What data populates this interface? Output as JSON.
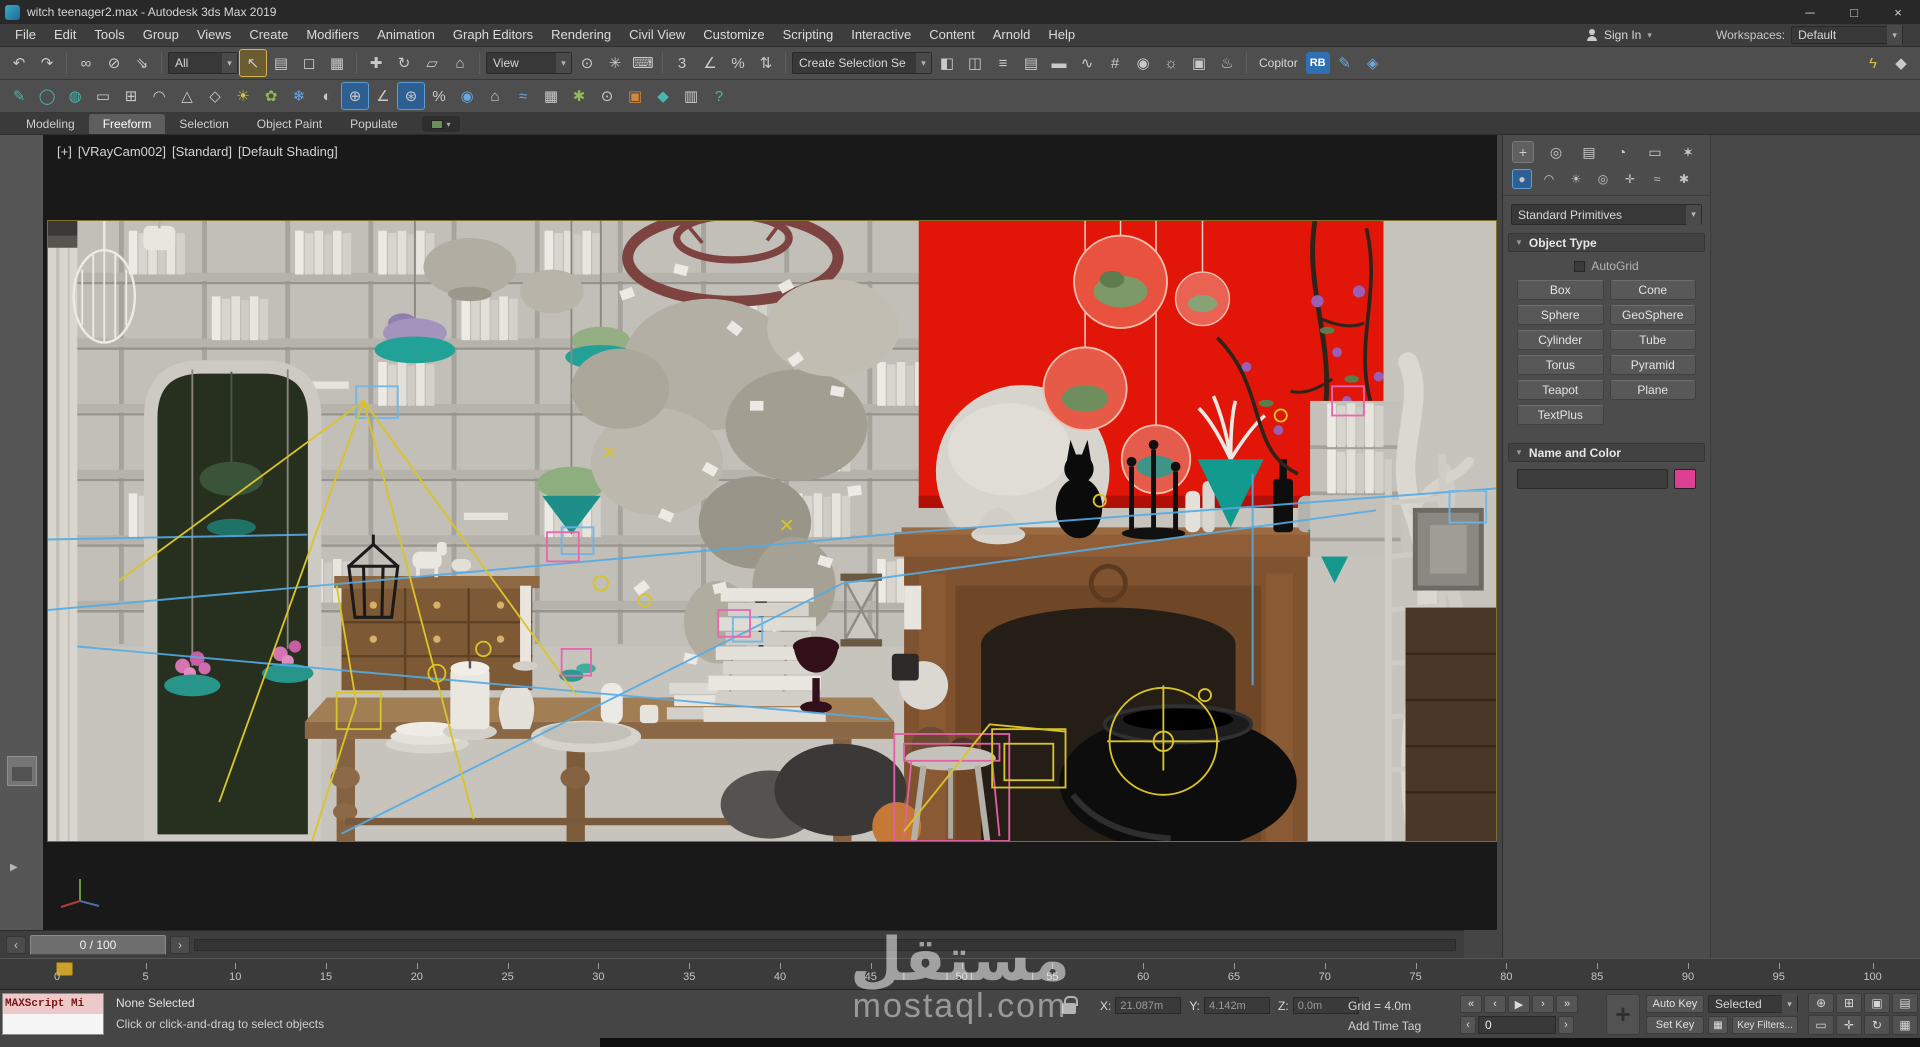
{
  "titlebar": {
    "title": "witch teenager2.max - Autodesk 3ds Max 2019"
  },
  "window_controls": [
    {
      "g": "─",
      "n": "minimize-button"
    },
    {
      "g": "□",
      "n": "maximize-button"
    },
    {
      "g": "×",
      "n": "close-button"
    }
  ],
  "menubar": {
    "items": [
      {
        "l": "File",
        "n": "menu-file"
      },
      {
        "l": "Edit",
        "n": "menu-edit"
      },
      {
        "l": "Tools",
        "n": "menu-tools"
      },
      {
        "l": "Group",
        "n": "menu-group"
      },
      {
        "l": "Views",
        "n": "menu-views"
      },
      {
        "l": "Create",
        "n": "menu-create"
      },
      {
        "l": "Modifiers",
        "n": "menu-modifiers"
      },
      {
        "l": "Animation",
        "n": "menu-animation"
      },
      {
        "l": "Graph Editors",
        "n": "menu-graph-editors"
      },
      {
        "l": "Rendering",
        "n": "menu-rendering"
      },
      {
        "l": "Civil View",
        "n": "menu-civil-view"
      },
      {
        "l": "Customize",
        "n": "menu-customize"
      },
      {
        "l": "Scripting",
        "n": "menu-scripting"
      },
      {
        "l": "Interactive",
        "n": "menu-interactive"
      },
      {
        "l": "Content",
        "n": "menu-content"
      },
      {
        "l": "Arnold",
        "n": "menu-arnold"
      },
      {
        "l": "Help",
        "n": "menu-help"
      }
    ],
    "signin": "Sign In",
    "workspaces_label": "Workspaces:",
    "workspace_value": "Default"
  },
  "toolbar1": {
    "g1": [
      {
        "g": "↶",
        "n": "undo-icon"
      },
      {
        "g": "↷",
        "n": "redo-icon"
      }
    ],
    "g2": [
      {
        "g": "∞",
        "n": "select-and-link-icon"
      },
      {
        "g": "⊘",
        "n": "unlink-selection-icon"
      },
      {
        "g": "⇘",
        "n": "bind-to-space-warp-icon"
      }
    ],
    "filter_value": "All",
    "g3": [
      {
        "g": "↖",
        "n": "select-object-icon",
        "s": "active"
      },
      {
        "g": "▤",
        "n": "select-by-name-icon"
      },
      {
        "g": "◻",
        "n": "rectangular-selection-region-icon"
      },
      {
        "g": "▦",
        "n": "window-crossing-icon"
      }
    ],
    "g4": [
      {
        "g": "✚",
        "n": "select-and-move-icon"
      },
      {
        "g": "↻",
        "n": "select-and-rotate-icon"
      },
      {
        "g": "▱",
        "n": "select-and-scale-icon"
      },
      {
        "g": "⌂",
        "n": "select-and-place-icon"
      }
    ],
    "coord_value": "View",
    "g5": [
      {
        "g": "⊙",
        "n": "use-pivot-point-center-icon"
      },
      {
        "g": "✳",
        "n": "select-and-manipulate-icon"
      },
      {
        "g": "⌨",
        "n": "keyboard-shortcut-override-icon"
      }
    ],
    "g6": [
      {
        "g": "3",
        "n": "snaps-toggle-icon"
      },
      {
        "g": "∠",
        "n": "angle-snap-toggle-icon"
      },
      {
        "g": "%",
        "n": "percent-snap-toggle-icon"
      },
      {
        "g": "⇅",
        "n": "spinner-snap-toggle-icon"
      }
    ],
    "selset_value": "Create Selection Se",
    "g7": [
      {
        "g": "◧",
        "n": "edit-named-selection-sets-icon"
      },
      {
        "g": "◫",
        "n": "mirror-icon"
      },
      {
        "g": "≡",
        "n": "align-icon"
      },
      {
        "g": "▤",
        "n": "toggle-scene-explorer-icon"
      },
      {
        "g": "▬",
        "n": "toggle-layer-explorer-icon"
      },
      {
        "g": "∿",
        "n": "curve-editor-icon"
      },
      {
        "g": "#",
        "n": "schematic-view-icon"
      },
      {
        "g": "◉",
        "n": "material-editor-icon"
      },
      {
        "g": "☼",
        "n": "render-setup-icon"
      },
      {
        "g": "▣",
        "n": "rendered-frame-window-icon"
      },
      {
        "g": "♨",
        "n": "render-production-icon"
      }
    ],
    "copitor": "Copitor",
    "rb": "RB",
    "g8": [
      {
        "g": "✎",
        "n": "script-icon",
        "c": "b"
      },
      {
        "g": "◈",
        "n": "plugin-icon",
        "c": "b"
      }
    ],
    "g9": [
      {
        "g": "ϟ",
        "n": "lightning-icon",
        "c": "y"
      },
      {
        "g": "◆",
        "n": "mode-icon"
      }
    ]
  },
  "toolbar2": {
    "icons": [
      {
        "g": "✎",
        "n": "draw-tool-icon",
        "c": "t"
      },
      {
        "g": "◯",
        "n": "circle-tool-icon",
        "c": "t"
      },
      {
        "g": "◍",
        "n": "sphere-tool-icon",
        "c": "t"
      },
      {
        "g": "▭",
        "n": "plane-tool-icon"
      },
      {
        "g": "⊞",
        "n": "box-tool-icon"
      },
      {
        "g": "◠",
        "n": "arc-tool-icon"
      },
      {
        "g": "△",
        "n": "cone-tool-icon"
      },
      {
        "g": "◇",
        "n": "diamond-tool-icon"
      },
      {
        "g": "☀",
        "n": "light-tool-icon",
        "c": "y"
      },
      {
        "g": "✿",
        "n": "foliage-tool-icon",
        "c": "g"
      },
      {
        "g": "❄",
        "n": "snow-tool-icon",
        "c": "b"
      },
      {
        "g": "◐",
        "n": "shading-icon"
      },
      {
        "g": "⊕",
        "n": "snap-2d-icon",
        "s": "active-blue"
      },
      {
        "g": "∠",
        "n": "angle-snap-icon"
      },
      {
        "g": "⊛",
        "n": "snap-3d-icon",
        "s": "active-blue"
      },
      {
        "g": "%",
        "n": "percent-snap-icon"
      },
      {
        "g": "◉",
        "n": "material-ball-icon",
        "c": "b"
      },
      {
        "g": "⌂",
        "n": "home-grid-icon"
      },
      {
        "g": "≈",
        "n": "wave-icon",
        "c": "b"
      },
      {
        "g": "▦",
        "n": "grid-icon"
      },
      {
        "g": "✱",
        "n": "system-icon",
        "c": "g"
      },
      {
        "g": "⊙",
        "n": "target-icon"
      },
      {
        "g": "▣",
        "n": "render-region-icon",
        "c": "o"
      },
      {
        "g": "◆",
        "n": "gem-icon",
        "c": "t"
      },
      {
        "g": "▥",
        "n": "list-icon"
      },
      {
        "g": "?",
        "n": "help-icon",
        "c": "t"
      }
    ]
  },
  "ribbon": {
    "tabs": [
      {
        "l": "Modeling",
        "n": "tab-modeling"
      },
      {
        "l": "Freeform",
        "n": "tab-freeform",
        "s": "active"
      },
      {
        "l": "Selection",
        "n": "tab-selection"
      },
      {
        "l": "Object Paint",
        "n": "tab-object-paint"
      },
      {
        "l": "Populate",
        "n": "tab-populate"
      }
    ]
  },
  "viewport": {
    "label_segments": [
      "[+]",
      "[VRayCam002]",
      "[Standard]",
      "[Default Shading]"
    ]
  },
  "command_panel": {
    "tabs": [
      {
        "g": "+",
        "n": "create-panel-tab-icon",
        "s": "active"
      },
      {
        "g": "◎",
        "n": "modify-panel-tab-icon"
      },
      {
        "g": "▤",
        "n": "hierarchy-panel-tab-icon"
      },
      {
        "g": "◔",
        "n": "motion-panel-tab-icon"
      },
      {
        "g": "▭",
        "n": "display-panel-tab-icon"
      },
      {
        "g": "✶",
        "n": "utilities-panel-tab-icon"
      }
    ],
    "categories": [
      {
        "g": "●",
        "n": "geometry-category-icon",
        "s": "active-blue"
      },
      {
        "g": "◠",
        "n": "shapes-category-icon"
      },
      {
        "g": "☀",
        "n": "lights-category-icon"
      },
      {
        "g": "◎",
        "n": "cameras-category-icon"
      },
      {
        "g": "✛",
        "n": "helpers-category-icon"
      },
      {
        "g": "≈",
        "n": "space-warps-category-icon"
      },
      {
        "g": "✱",
        "n": "systems-category-icon"
      }
    ],
    "dropdown_value": "Standard Primitives",
    "object_type": {
      "title": "Object Type",
      "autogrid": "AutoGrid",
      "buttons": [
        {
          "l": "Box",
          "n": "box-button"
        },
        {
          "l": "Cone",
          "n": "cone-button"
        },
        {
          "l": "Sphere",
          "n": "sphere-button"
        },
        {
          "l": "GeoSphere",
          "n": "geosphere-button"
        },
        {
          "l": "Cylinder",
          "n": "cylinder-button"
        },
        {
          "l": "Tube",
          "n": "tube-button"
        },
        {
          "l": "Torus",
          "n": "torus-button"
        },
        {
          "l": "Pyramid",
          "n": "pyramid-button"
        },
        {
          "l": "Teapot",
          "n": "teapot-button"
        },
        {
          "l": "Plane",
          "n": "plane-button"
        },
        {
          "l": "TextPlus",
          "n": "textplus-button"
        }
      ]
    },
    "name_color": {
      "title": "Name and Color",
      "swatch_style": "background:#dd3f92"
    }
  },
  "timeline": {
    "frame_display": "0 / 100",
    "ticks": [
      "0",
      "5",
      "10",
      "15",
      "20",
      "25",
      "30",
      "35",
      "40",
      "45",
      "50",
      "55",
      "60",
      "65",
      "70",
      "75",
      "80",
      "85",
      "90",
      "95",
      "100"
    ]
  },
  "statusbar": {
    "maxscript": "MAXScript Mi",
    "selection_status": "None Selected",
    "prompt": "Click or click-and-drag to select objects",
    "x_label": "X:",
    "x_value": "21.087m",
    "y_label": "Y:",
    "y_value": "4.142m",
    "z_label": "Z:",
    "z_value": "0.0m",
    "grid": "Grid = 4.0m",
    "add_time_tag": "Add Time Tag",
    "frame_value": "0",
    "auto_key": "Auto Key",
    "set_key": "Set Key",
    "selected_value": "Selected",
    "key_filters": "Key Filters...",
    "playback": [
      {
        "g": "«",
        "n": "go-to-start-button"
      },
      {
        "g": "‹",
        "n": "previous-frame-button"
      },
      {
        "g": "▶",
        "n": "play-button"
      },
      {
        "g": "›",
        "n": "next-frame-button"
      },
      {
        "g": "»",
        "n": "go-to-end-button"
      }
    ],
    "nav": [
      {
        "g": "⊕",
        "n": "zoom-icon"
      },
      {
        "g": "⊞",
        "n": "zoom-all-icon"
      },
      {
        "g": "▣",
        "n": "zoom-extents-icon"
      },
      {
        "g": "▤",
        "n": "zoom-extents-all-icon"
      },
      {
        "g": "▭",
        "n": "zoom-region-icon"
      },
      {
        "g": "✛",
        "n": "pan-icon"
      },
      {
        "g": "↻",
        "n": "orbit-icon"
      },
      {
        "g": "▦",
        "n": "maximize-viewport-toggle-icon"
      }
    ]
  },
  "watermark": {
    "arabic": "مستقل",
    "latin": "mostaql.com"
  },
  "misc": {
    "dd_arrow": "▾",
    "rollout_arrow": "▼",
    "strip_arrow": "▶",
    "slider_prev": "‹",
    "slider_next": "›",
    "big_key": "+"
  },
  "colors": {
    "active_tool_highlight": "#d8b64a",
    "active_blue_highlight": "#2d5f93",
    "name_color_swatch": "#dd3f92",
    "scene_red_wall": "#e11508"
  }
}
